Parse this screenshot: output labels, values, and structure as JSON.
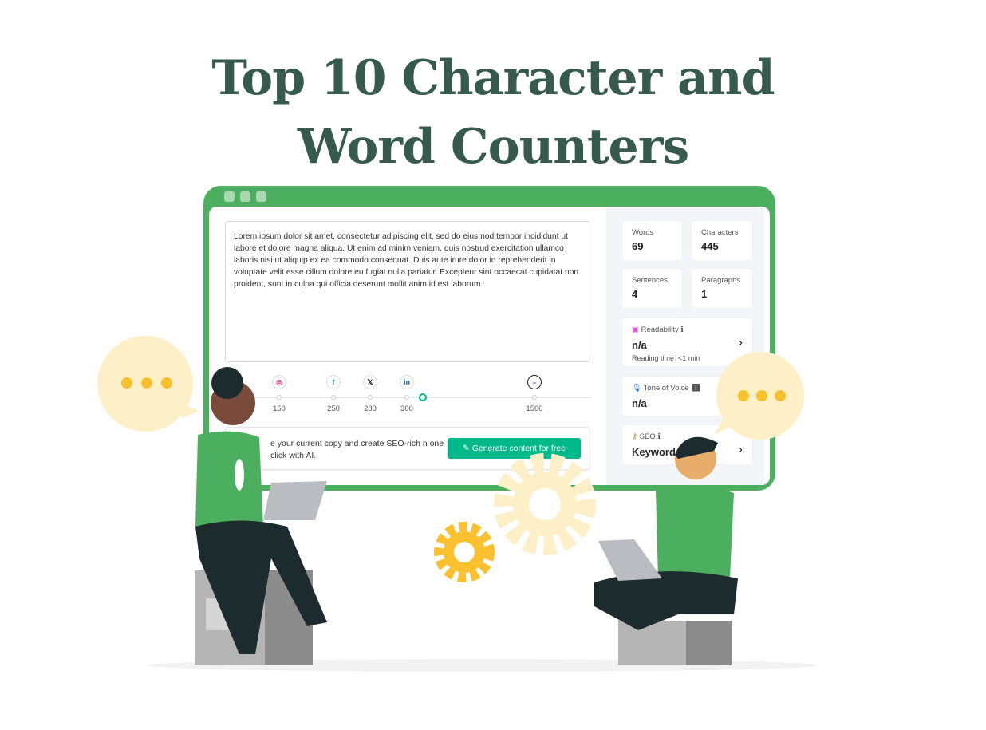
{
  "title": {
    "line1": "Top 10 Character and",
    "line2": "Word Counters"
  },
  "editor": {
    "text": "Lorem ipsum dolor sit amet, consectetur adipiscing elit, sed do eiusmod tempor incididunt ut labore et dolore magna aliqua. Ut enim ad minim veniam, quis nostrud exercitation ullamco laboris nisi ut aliquip ex ea commodo consequat. Duis aute irure dolor in reprehenderit in voluptate velit esse cillum dolore eu fugiat nulla pariatur. Excepteur sint occaecat cupidatat non proident, sunt in culpa qui officia deserunt mollit anim id est laborum."
  },
  "limits": [
    {
      "icon": "instagram-icon",
      "value": "150"
    },
    {
      "icon": "facebook-icon",
      "value": "250"
    },
    {
      "icon": "x-icon",
      "value": "280"
    },
    {
      "icon": "linkedin-icon",
      "value": "300"
    },
    {
      "icon": "document-icon",
      "value": "1500"
    }
  ],
  "generate": {
    "text": "e your current copy and create SEO-rich n one click with AI.",
    "button": "Generate content for free"
  },
  "stats": {
    "words": {
      "label": "Words",
      "value": "69"
    },
    "characters": {
      "label": "Characters",
      "value": "445"
    },
    "sentences": {
      "label": "Sentences",
      "value": "4"
    },
    "paragraphs": {
      "label": "Paragraphs",
      "value": "1"
    }
  },
  "readability": {
    "label": "Readability",
    "value": "n/a",
    "sub": "Reading time: <1 min"
  },
  "tone": {
    "label": "Tone of Voice",
    "value": "n/a"
  },
  "seo": {
    "label": "SEO",
    "value": "Keyword"
  },
  "colors": {
    "frame": "#4caf5f",
    "title": "#375a4f",
    "button": "#00b98b",
    "gear": "#fbc02d"
  }
}
